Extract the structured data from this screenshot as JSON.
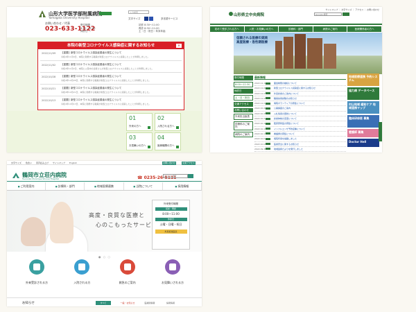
{
  "panel1": {
    "hospital_name": "山形大学医学部附属病院",
    "hospital_sub": "Yamagata University Hospital",
    "search_placeholder": "入力検索",
    "font_size_label": "文字サイズ",
    "lang_label": "多言語サービス",
    "tel_caption": "お問い合わせ／代表",
    "tel": "023-633-1122",
    "hours": [
      "受付時間 ...",
      "8:30 - 11:00",
      "休診日 ..."
    ],
    "schedule": [
      "初診 8:30〜11:00",
      "再診 8:30〜11:00",
      "土・日・祝日・年末年始"
    ],
    "notice": {
      "title": "本院の新型コロナウイルス感染症に関するお知らせ",
      "close": "×",
      "items": [
        {
          "date": "2022/11/09",
          "title": "【重要】新型コロナウイルス感染症患者の発生について",
          "body": "令和4年11月9日、本院に勤務する職員が新型コロナウイルスに感染したことが判明しました。"
        },
        {
          "date": "2022/11/02",
          "title": "【重要】新型コロナウイルス感染症患者の発生について",
          "body": "令和4年11月2日、本院に入院中の患者さんが新型コロナウイルスに感染したことが判明しました。"
        },
        {
          "date": "2022/10/28",
          "title": "【重要】新型コロナウイルス感染症患者の発生について",
          "body": "令和4年10月28日、本院に勤務する職員が新型コロナウイルスに感染したことが判明しました。"
        },
        {
          "date": "2022/10/21",
          "title": "【重要】新型コロナウイルス感染症患者の発生について",
          "body": "令和4年10月21日、本院に勤務する職員が新型コロナウイルスに感染したことが判明しました。"
        },
        {
          "date": "2022/10/13",
          "title": "【重要】新型コロナウイルス感染症患者の発生について",
          "body": "令和4年10月13日、本院に勤務する職員が新型コロナウイルスに感染したことが判明しました。"
        }
      ]
    },
    "tiles": [
      {
        "num": "01",
        "label": "外来の方へ"
      },
      {
        "num": "02",
        "label": "入院される方へ"
      },
      {
        "num": "03",
        "label": "お見舞いの方へ"
      },
      {
        "num": "04",
        "label": "医療機関の方へ"
      }
    ]
  },
  "panel2": {
    "hospital_name": "山形県立中央病院",
    "util": "サイトマップ ｜ 文字サイズ ｜ アクセス ｜ お問い合わせ",
    "search_placeholder": "Google 検索",
    "nav": [
      "初めて受診される方へ",
      "入院・お見舞いの方へ",
      "診療科・部門",
      "病院のご案内",
      "医療関係者の方へ"
    ],
    "hero_text": [
      "信頼される医療の実践",
      "高度医療・急性期医療"
    ],
    "left_blocks": [
      "受付時間",
      "8:00〜11:30",
      "休診日",
      "土・日・祝日",
      "交通アクセス",
      "お問い合わせ"
    ],
    "left_boxes": [
      "外来担当医表",
      "診療科のご案内",
      "病院のご案内"
    ],
    "news_heading": "最新情報",
    "news": [
      {
        "date": "2022.11.10",
        "title": "面会制限の継続について"
      },
      {
        "date": "2022.11.09",
        "title": "新型コロナウイルス感染症に関するお知らせ"
      },
      {
        "date": "2022.11.07",
        "title": "外来診療のご案内について"
      },
      {
        "date": "2022.11.04",
        "title": "職員採用試験のお知らせ"
      },
      {
        "date": "2022.11.01",
        "title": "病院ボランティアの募集について"
      },
      {
        "date": "2022.10.28",
        "title": "公開講座のご案内"
      },
      {
        "date": "2022.10.25",
        "title": "入札情報の更新について"
      },
      {
        "date": "2022.10.21",
        "title": "診療体制の変更について"
      },
      {
        "date": "2022.10.18",
        "title": "臨床研修医の募集について"
      },
      {
        "date": "2022.10.14",
        "title": "インフルエンザ予防接種について"
      },
      {
        "date": "2022.10.11",
        "title": "看護師の募集について"
      },
      {
        "date": "2022.10.07",
        "title": "病院年報を掲載しました"
      },
      {
        "date": "2022.10.04",
        "title": "医療安全に関するお知らせ"
      },
      {
        "date": "2022.09.30",
        "title": "地域連携だよりを発行しました"
      }
    ],
    "banners": [
      {
        "text": "地域医療連携 予約システム",
        "color": "#d9a441"
      },
      {
        "text": "協力病 データベース",
        "color": "#2f7a3b"
      },
      {
        "text": "村山地域 緩和ケア 地域連携マップ",
        "color": "#4a90c0"
      },
      {
        "text": "臨床研修医 募集",
        "color": "#3a6fb5"
      },
      {
        "text": "看護師 募集",
        "color": "#e07b9a"
      },
      {
        "text": "Doctor Hell",
        "color": "#1a3b8a"
      }
    ]
  },
  "panel3": {
    "util": [
      "文字サイズ",
      "色合い",
      "音声読み上げ",
      "サイトマップ",
      "English"
    ],
    "util_buttons": [
      "お問い合わせ",
      "交通アクセス"
    ],
    "hospital_name": "鶴岡市立荘内病院",
    "hospital_sub": "Tsuruoka Municipal Shonai Hospital",
    "tel": "0235-26-5111",
    "search_placeholder": "Google 検索",
    "nav": [
      "ご利用案内",
      "診療科・部門",
      "地域医療連携",
      "当院について",
      "採用情報"
    ],
    "catch1": "高度・良質な医療と",
    "catch2": "心のこもったサービス",
    "hours_heading": "外来受付時間",
    "hours_tag": "初診・再診",
    "hours_value": "8:00〜11:00",
    "holiday_tag": "休診日",
    "holiday_value": "土曜・日曜・祝日",
    "hours_link": "外来担当医表",
    "quick": [
      {
        "label": "外来受診される方",
        "color": "#3aa0a0"
      },
      {
        "label": "入院される方",
        "color": "#3a9fd0"
      },
      {
        "label": "救急のご案内",
        "color": "#d94a3a"
      },
      {
        "label": "お見舞いされる方",
        "color": "#8a5fb5"
      }
    ],
    "news_label": "お知らせ",
    "news_tabs": [
      "すべて",
      "一般・お知らせ",
      "医療関係者",
      "採用情報"
    ]
  }
}
